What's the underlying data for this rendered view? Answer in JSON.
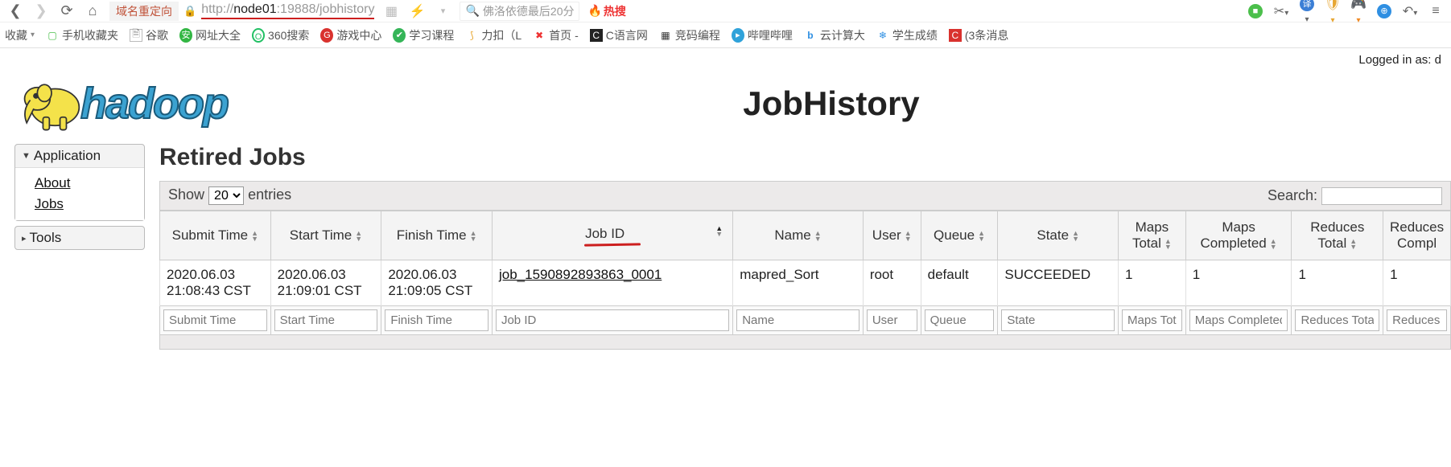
{
  "browser": {
    "redirect_label": "域名重定向",
    "url_pre": "http://",
    "url_host": "node01",
    "url_post": ":19888/jobhistory",
    "search_placeholder": "佛洛依德最后20分",
    "hot_label": "热搜"
  },
  "bookmarks": {
    "fav_label": "收藏",
    "items": [
      "手机收藏夹",
      "谷歌",
      "网址大全",
      "360搜索",
      "游戏中心",
      "学习课程",
      "力扣（L",
      "首页 -",
      "C语言网",
      "竞码编程",
      "哔哩哔哩",
      "云计算大",
      "学生成绩",
      "(3条消息"
    ]
  },
  "login_text": "Logged in as: d",
  "logo_text": "hadoop",
  "page_title": "JobHistory",
  "sidebar": {
    "app_header": "Application",
    "about": "About",
    "jobs": "Jobs",
    "tools_header": "Tools"
  },
  "section_title": "Retired Jobs",
  "dt": {
    "show_label": "Show",
    "entries_label": "entries",
    "page_size": "20",
    "search_label": "Search:",
    "headers": {
      "submit": "Submit Time",
      "start": "Start Time",
      "finish": "Finish Time",
      "jobid": "Job ID",
      "name": "Name",
      "user": "User",
      "queue": "Queue",
      "state": "State",
      "maps_total": "Maps Total",
      "maps_completed": "Maps Completed",
      "reduces_total": "Reduces Total",
      "reduces_completed": "Reduces Compl"
    },
    "filters": {
      "submit": "Submit Time",
      "start": "Start Time",
      "finish": "Finish Time",
      "jobid": "Job ID",
      "name": "Name",
      "user": "User",
      "queue": "Queue",
      "state": "State",
      "maps_total": "Maps Total",
      "maps_completed": "Maps Completed",
      "reduces_total": "Reduces Total",
      "reduces_completed": "Reduces Completed"
    },
    "row": {
      "submit": "2020.06.03 21:08:43 CST",
      "start": "2020.06.03 21:09:01 CST",
      "finish": "2020.06.03 21:09:05 CST",
      "jobid": "job_1590892893863_0001",
      "name": "mapred_Sort",
      "user": "root",
      "queue": "default",
      "state": "SUCCEEDED",
      "maps_total": "1",
      "maps_completed": "1",
      "reduces_total": "1",
      "reduces_completed": "1"
    }
  }
}
